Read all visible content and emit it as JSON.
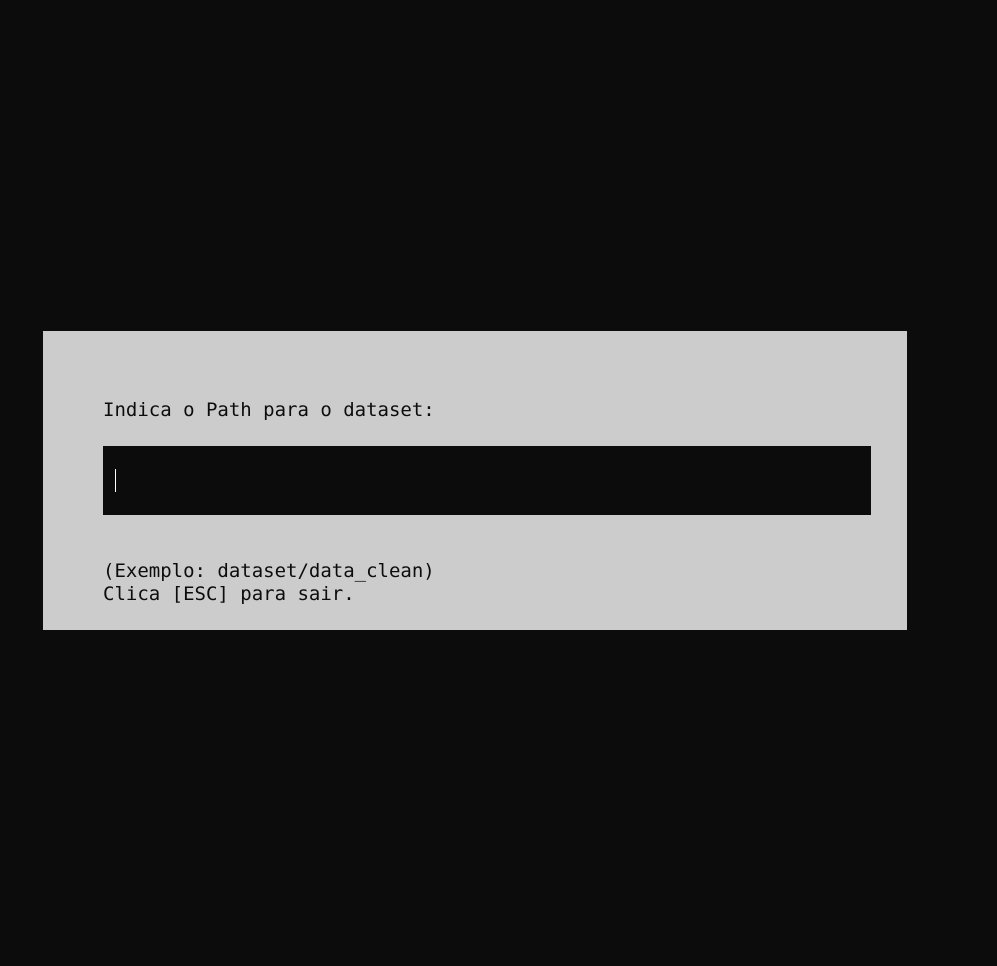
{
  "dialog": {
    "prompt": "Indica o Path para o dataset:",
    "input": {
      "value": "",
      "placeholder": ""
    },
    "example": "(Exemplo: dataset/data_clean)",
    "exit_hint": "Clica [ESC] para sair."
  },
  "colors": {
    "background": "#0c0c0c",
    "dialog_background": "#cccccc",
    "input_background": "#0c0c0c",
    "text": "#0c0c0c",
    "cursor": "#ffffff"
  }
}
